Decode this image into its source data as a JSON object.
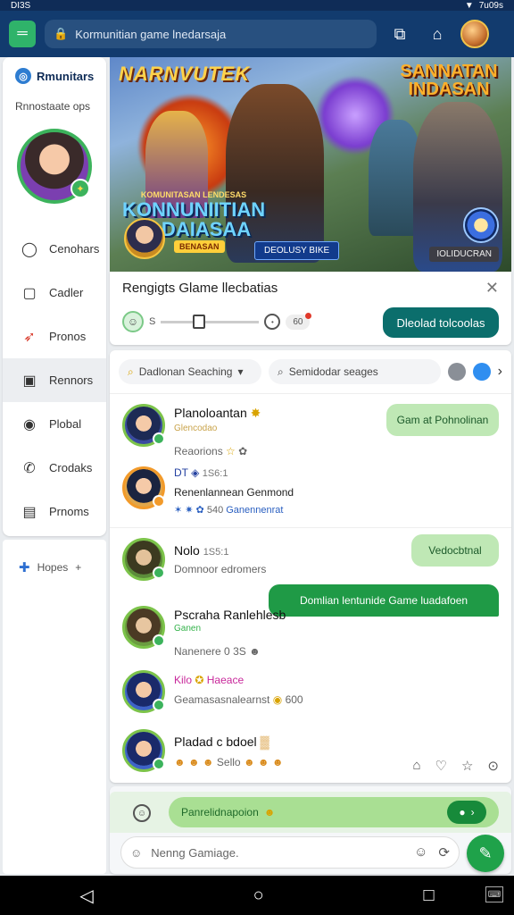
{
  "status_bar": {
    "left": "DI3S",
    "right": "7u09s"
  },
  "browser": {
    "url": "Kormunitian game lnedarsaja"
  },
  "sidebar": {
    "brand": "Rmunitars",
    "subtitle": "Rnnostaate ops",
    "items": [
      {
        "label": "Cenohars",
        "icon": "chat-bubble-icon"
      },
      {
        "label": "Cadler",
        "icon": "folder-icon"
      },
      {
        "label": "Pronos",
        "icon": "rocket-icon"
      },
      {
        "label": "Rennors",
        "icon": "gallery-icon"
      },
      {
        "label": "Plobal",
        "icon": "gamepad-icon"
      },
      {
        "label": "Crodaks",
        "icon": "phone-icon"
      },
      {
        "label": "Prnoms",
        "icon": "note-icon"
      }
    ],
    "hopes": "Hopes"
  },
  "hero": {
    "title_left": "NARNVUTEK",
    "title_right": "SANNATAN INDASAN",
    "logo_small": "KOMUNITASAN LENDESAS",
    "logo": "KONNUNIITIAN JADAIASAA",
    "tag1": "BENASAN",
    "tag2": "DEOLUSY BIKE",
    "tag3": "IOLIDUCRAN"
  },
  "notice": {
    "title": "Rengigts Glame llecbatias",
    "count_left": "S",
    "count_pill": "60",
    "button": "Dleolad tolcoolas"
  },
  "chat": {
    "search_left": "Dadlonan Seaching",
    "search_right": "Semidodar seages",
    "messages": [
      {
        "name": "Planoloantan",
        "sub": "Reaorions",
        "tag": "Glencodao"
      },
      {
        "name": "DT",
        "time": "1S6:1",
        "sub": "Renenlannean Genmond",
        "reacts": "Ganennenrat",
        "reacts_count": "540"
      },
      {
        "name": "Nolo",
        "time": "1S5:1",
        "sub": "Domnoor edromers"
      },
      {
        "name": "Pscraha Ranlehlesb",
        "sub": "Ganen",
        "detail": "Nanenere 0",
        "detail_count": "3S"
      },
      {
        "name": "Kilo",
        "name2": "Haeace",
        "sub": "Geamasasnalearnst",
        "count": "600"
      },
      {
        "name": "Pladad c bdoel",
        "count": "Sello"
      }
    ],
    "bubble_1": "Gam at Pohnolinan",
    "bubble_2": "Vedocbtnal",
    "bubble_3": "Domlian lentunide Game luadafoen"
  },
  "composer": {
    "pill_text": "Panrelidnapoion",
    "placeholder": "Nenng Gamiage."
  },
  "colors": {
    "accent": "#1f9a46",
    "header": "#123b6e",
    "button": "#0b6e6c"
  }
}
